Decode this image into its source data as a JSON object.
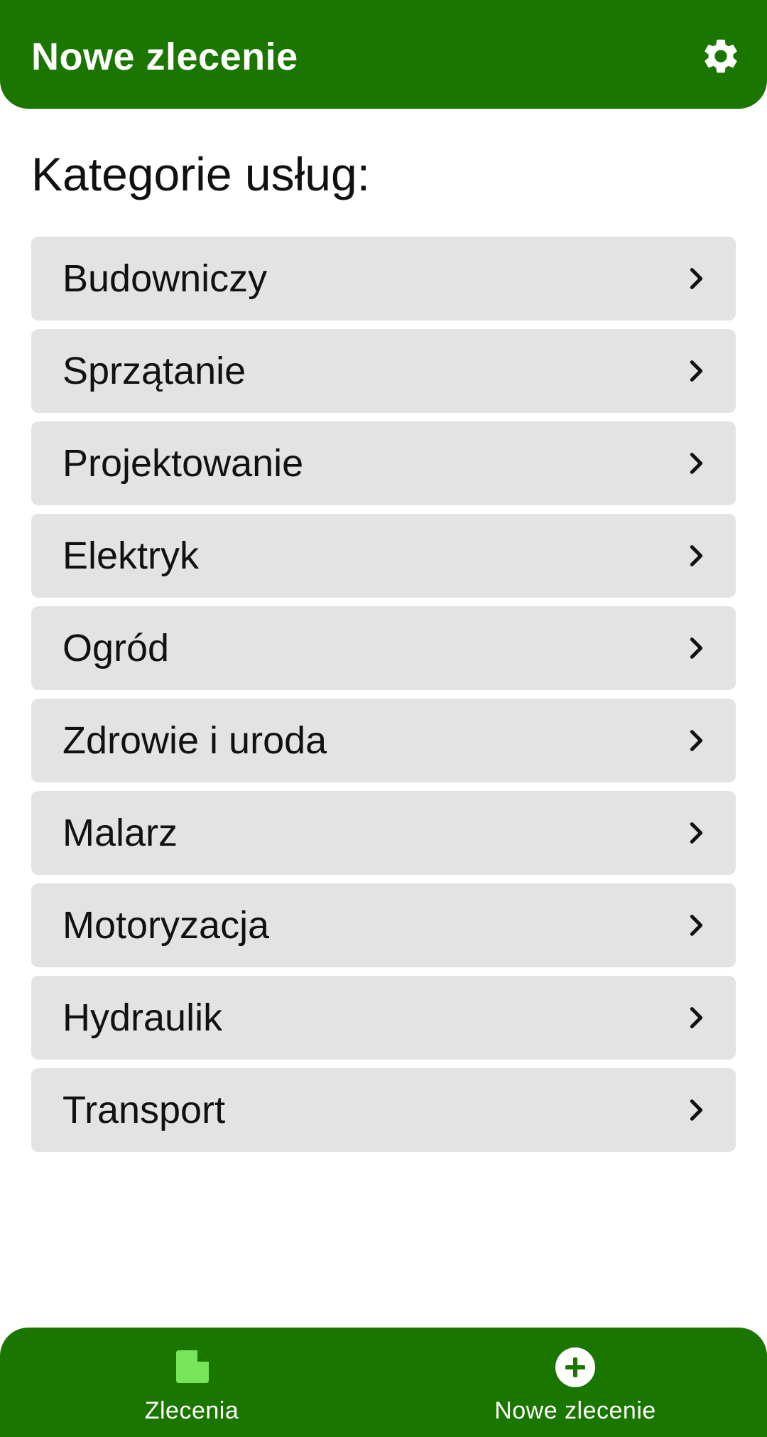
{
  "header": {
    "title": "Nowe zlecenie",
    "settings_icon": "gear-icon"
  },
  "main": {
    "section_title": "Kategorie usług:",
    "categories": [
      {
        "label": "Budowniczy"
      },
      {
        "label": "Sprzątanie"
      },
      {
        "label": "Projektowanie"
      },
      {
        "label": "Elektryk"
      },
      {
        "label": "Ogród"
      },
      {
        "label": "Zdrowie i uroda"
      },
      {
        "label": "Malarz"
      },
      {
        "label": "Motoryzacja"
      },
      {
        "label": "Hydraulik"
      },
      {
        "label": "Transport"
      }
    ]
  },
  "bottom_nav": {
    "items": [
      {
        "label": "Zlecenia",
        "icon": "document-icon"
      },
      {
        "label": "Nowe zlecenie",
        "icon": "add-circle-icon"
      }
    ]
  },
  "colors": {
    "brand_green": "#1b7600",
    "active_icon_green": "#77e55a",
    "item_background": "#e3e3e3",
    "text": "#111111"
  }
}
